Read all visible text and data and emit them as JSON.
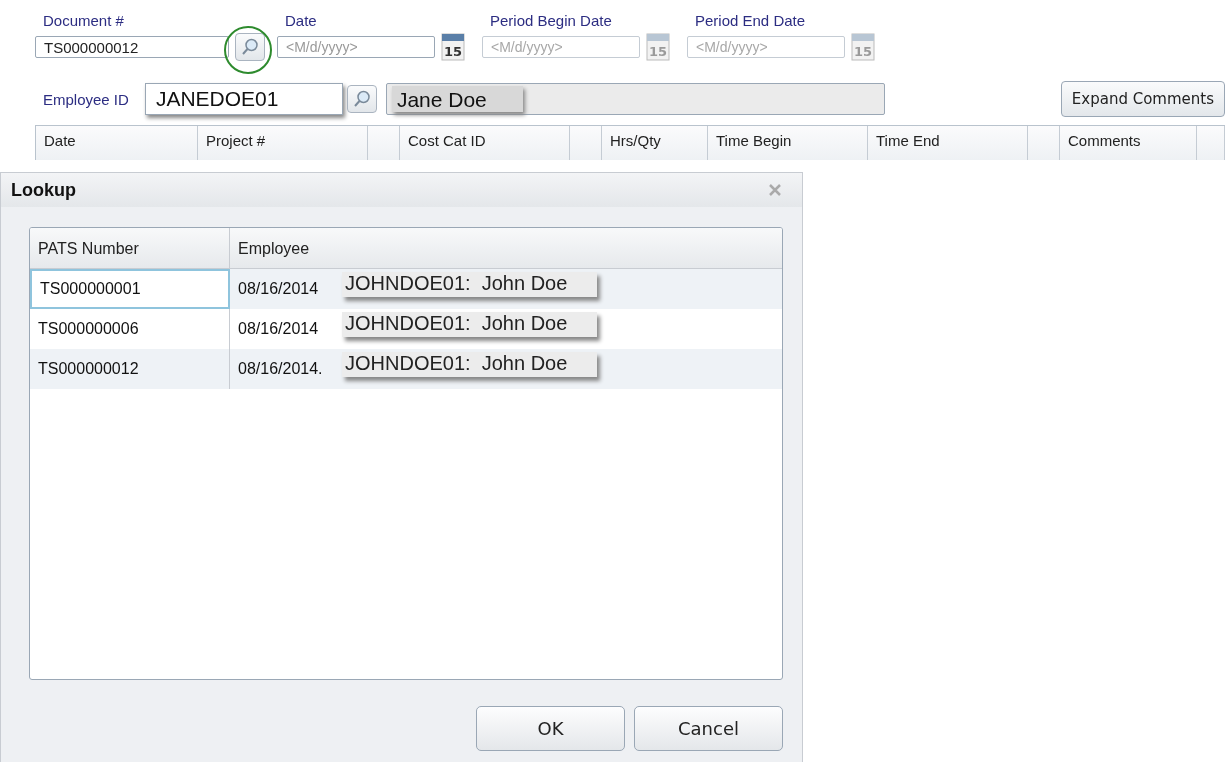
{
  "form": {
    "document": {
      "label": "Document #",
      "value": "TS000000012"
    },
    "date_fields": [
      {
        "label": "Date",
        "placeholder": "<M/d/yyyy>",
        "calendar_day": "15",
        "disabled": false
      },
      {
        "label": "Period Begin Date",
        "placeholder": "<M/d/yyyy>",
        "calendar_day": "15",
        "disabled": true
      },
      {
        "label": "Period End Date",
        "placeholder": "<M/d/yyyy>",
        "calendar_day": "15",
        "disabled": true
      }
    ],
    "employee": {
      "label": "Employee ID",
      "value": "JANEDOE01",
      "name": "Jane Doe"
    },
    "expand_button": "Expand Comments",
    "columns": [
      "Date",
      "Project #",
      "",
      "Cost Cat ID",
      "",
      "Hrs/Qty",
      "Time Begin",
      "Time End",
      "",
      "Comments",
      ""
    ]
  },
  "dialog": {
    "title": "Lookup",
    "columns": [
      "PATS Number",
      "Employee"
    ],
    "rows": [
      {
        "pats": "TS000000001",
        "date": "08/16/2014",
        "employee": "JOHNDOE01:  John Doe",
        "selected": true
      },
      {
        "pats": "TS000000006",
        "date": "08/16/2014",
        "employee": "JOHNDOE01:  John Doe",
        "selected": false
      },
      {
        "pats": "TS000000012",
        "date": "08/16/2014.",
        "employee": "JOHNDOE01:  John Doe",
        "selected": false
      }
    ],
    "buttons": [
      "OK",
      "Cancel"
    ]
  }
}
